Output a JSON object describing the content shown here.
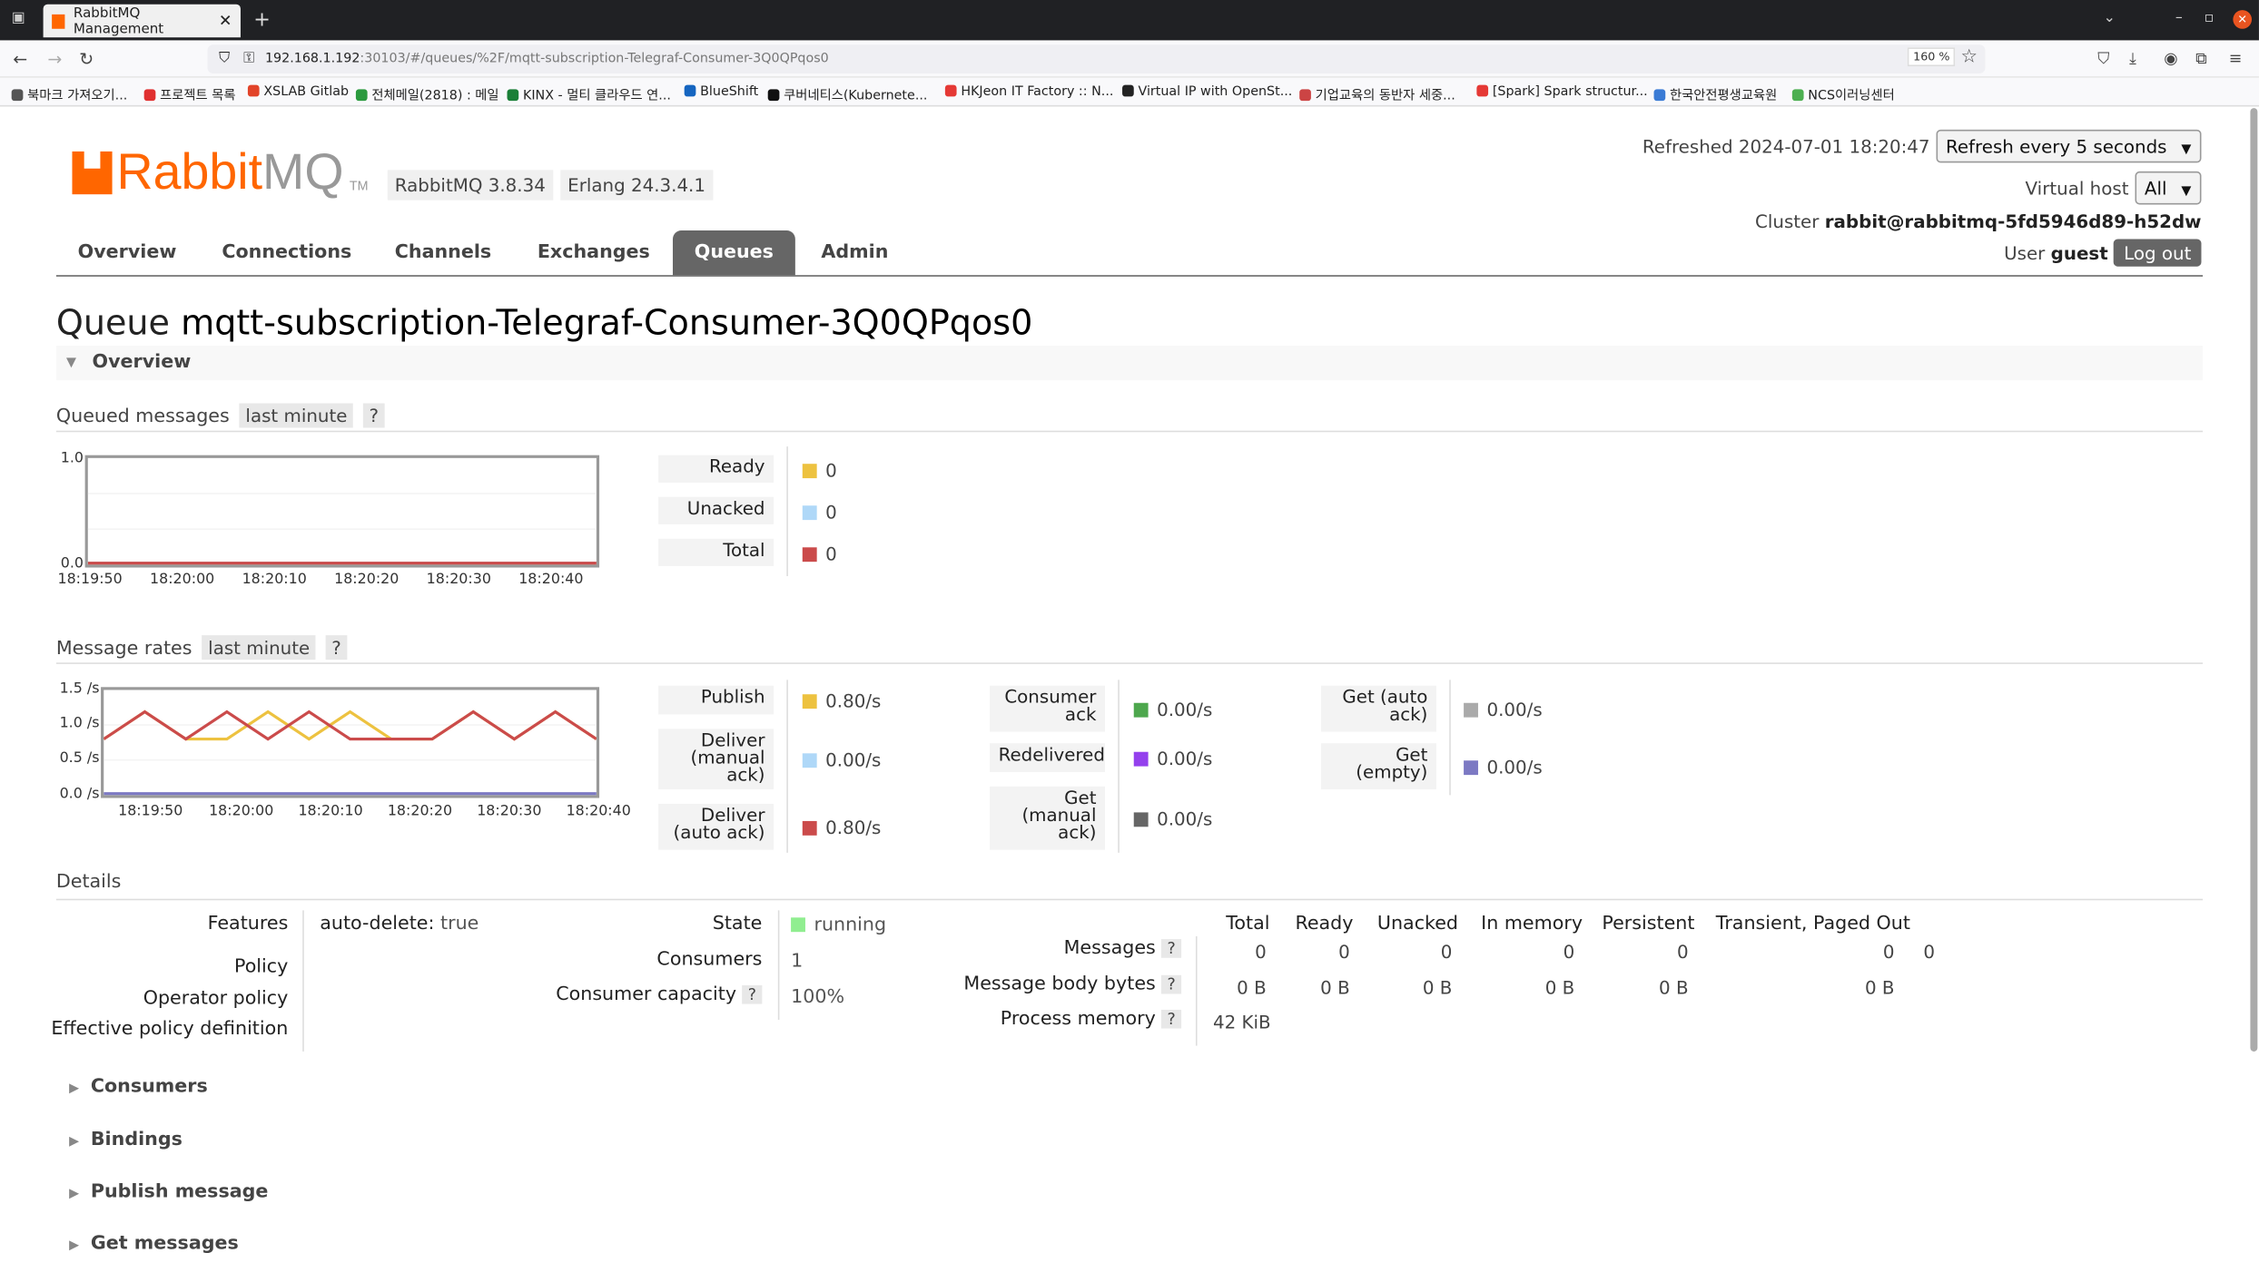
{
  "browser": {
    "tab_title": "RabbitMQ Management",
    "url_host": "192.168.1.192",
    "url_rest": ":30103/#/queues/%2F/mqtt-subscription-Telegraf-Consumer-3Q0QPqos0",
    "zoom": "160 %",
    "bookmarks": [
      "북마크 가져오기...",
      "프로젝트 목록",
      "XSLAB Gitlab",
      "전체메일(2818) : 메일",
      "KINX - 멀티 클라우드 연...",
      "BlueShift",
      "쿠버네티스(Kubernete...",
      "HKJeon IT Factory :: N...",
      "Virtual IP with OpenSt...",
      "기업교육의 동반자 세중...",
      "[Spark] Spark structur...",
      "한국안전평생교육원",
      "NCS이러닝센터"
    ],
    "bookmark_colors": [
      "#555555",
      "#e03030",
      "#e24329",
      "#2b9a3e",
      "#1a7f37",
      "#1565c0",
      "#111111",
      "#e53935",
      "#222222",
      "#cc4444",
      "#e53935",
      "#3a7bd5",
      "#4caf50"
    ]
  },
  "header": {
    "logo_rabbit": "Rabbit",
    "logo_mq": "MQ",
    "logo_tm": "TM",
    "version": "RabbitMQ 3.8.34",
    "erlang": "Erlang 24.3.4.1",
    "refreshed_label": "Refreshed 2024-07-01 18:20:47",
    "refresh_select": "Refresh every 5 seconds",
    "vhost_label": "Virtual host",
    "vhost_select": "All",
    "cluster_label": "Cluster",
    "cluster_value": "rabbit@rabbitmq-5fd5946d89-h52dw",
    "user_label": "User",
    "user_value": "guest",
    "logout": "Log out"
  },
  "nav": {
    "tabs": [
      "Overview",
      "Connections",
      "Channels",
      "Exchanges",
      "Queues",
      "Admin"
    ],
    "active": "Queues"
  },
  "page": {
    "title_prefix": "Queue",
    "title_name": "mqtt-subscription-Telegraf-Consumer-3Q0QPqos0",
    "overview_section": "Overview",
    "queued_title": "Queued messages",
    "rates_title": "Message rates",
    "range": "last minute",
    "help": "?"
  },
  "queued": {
    "y_ticks": [
      "1.0",
      "0.0"
    ],
    "x_ticks": [
      "18:19:50",
      "18:20:00",
      "18:20:10",
      "18:20:20",
      "18:20:30",
      "18:20:40"
    ],
    "legend": [
      {
        "label": "Ready",
        "value": "0",
        "color": "#edc240"
      },
      {
        "label": "Unacked",
        "value": "0",
        "color": "#afd8f8"
      },
      {
        "label": "Total",
        "value": "0",
        "color": "#cb4b4b"
      }
    ]
  },
  "rates": {
    "y_ticks": [
      "1.5 /s",
      "1.0 /s",
      "0.5 /s",
      "0.0 /s"
    ],
    "x_ticks": [
      "18:19:50",
      "18:20:00",
      "18:20:10",
      "18:20:20",
      "18:20:30",
      "18:20:40"
    ],
    "col1": [
      {
        "label": "Publish",
        "value": "0.80/s",
        "color": "#edc240"
      },
      {
        "label": "Deliver (manual ack)",
        "value": "0.00/s",
        "color": "#afd8f8"
      },
      {
        "label": "Deliver (auto ack)",
        "value": "0.80/s",
        "color": "#cb4b4b"
      }
    ],
    "col2": [
      {
        "label": "Consumer ack",
        "value": "0.00/s",
        "color": "#4da74d"
      },
      {
        "label": "Redelivered",
        "value": "0.00/s",
        "color": "#9440ed"
      },
      {
        "label": "Get (manual ack)",
        "value": "0.00/s",
        "color": "#666666"
      }
    ],
    "col3": [
      {
        "label": "Get (auto ack)",
        "value": "0.00/s",
        "color": "#aaaaaa"
      },
      {
        "label": "Get (empty)",
        "value": "0.00/s",
        "color": "#7c79c3"
      }
    ]
  },
  "chart_data": [
    {
      "type": "line",
      "title": "Queued messages",
      "x": [
        "18:19:50",
        "18:20:00",
        "18:20:10",
        "18:20:20",
        "18:20:30",
        "18:20:40"
      ],
      "ylim": [
        0,
        1
      ],
      "series": [
        {
          "name": "Ready",
          "values": [
            0,
            0,
            0,
            0,
            0,
            0
          ]
        },
        {
          "name": "Unacked",
          "values": [
            0,
            0,
            0,
            0,
            0,
            0
          ]
        },
        {
          "name": "Total",
          "values": [
            0,
            0,
            0,
            0,
            0,
            0
          ]
        }
      ]
    },
    {
      "type": "line",
      "title": "Message rates",
      "x": [
        "18:19:45",
        "18:19:50",
        "18:19:55",
        "18:20:00",
        "18:20:05",
        "18:20:10",
        "18:20:15",
        "18:20:20",
        "18:20:25",
        "18:20:30",
        "18:20:35",
        "18:20:40",
        "18:20:45"
      ],
      "ylim": [
        0,
        1.5
      ],
      "series": [
        {
          "name": "Publish",
          "values": [
            0.8,
            1.2,
            0.8,
            0.8,
            1.2,
            0.8,
            1.2,
            0.8,
            0.8,
            1.2,
            0.8,
            1.2,
            0.8
          ]
        },
        {
          "name": "Deliver (auto ack)",
          "values": [
            0.8,
            1.2,
            0.8,
            1.2,
            0.8,
            1.2,
            0.8,
            0.8,
            0.8,
            1.2,
            0.8,
            1.2,
            0.8
          ]
        },
        {
          "name": "Deliver (manual ack)",
          "values": [
            0,
            0,
            0,
            0,
            0,
            0,
            0,
            0,
            0,
            0,
            0,
            0,
            0
          ]
        }
      ]
    }
  ],
  "details": {
    "title": "Details",
    "features_label": "Features",
    "features_key": "auto-delete:",
    "features_val": "true",
    "policy_label": "Policy",
    "op_policy_label": "Operator policy",
    "eff_policy_label": "Effective policy definition",
    "state_label": "State",
    "state_value": "running",
    "state_color": "#90ee90",
    "consumers_label": "Consumers",
    "consumers_value": "1",
    "capacity_label": "Consumer capacity",
    "capacity_value": "100%",
    "table_headers": [
      "Total",
      "Ready",
      "Unacked",
      "In memory",
      "Persistent",
      "Transient, Paged Out"
    ],
    "rows": [
      {
        "label": "Messages",
        "cells": [
          "0",
          "0",
          "0",
          "0",
          "0",
          "0",
          "0"
        ]
      },
      {
        "label": "Message body bytes",
        "cells": [
          "0 B",
          "0 B",
          "0 B",
          "0 B",
          "0 B",
          "0 B"
        ]
      },
      {
        "label": "Process memory",
        "cells": [
          "42 KiB"
        ]
      }
    ]
  },
  "collapsed": [
    "Consumers",
    "Bindings",
    "Publish message",
    "Get messages"
  ]
}
